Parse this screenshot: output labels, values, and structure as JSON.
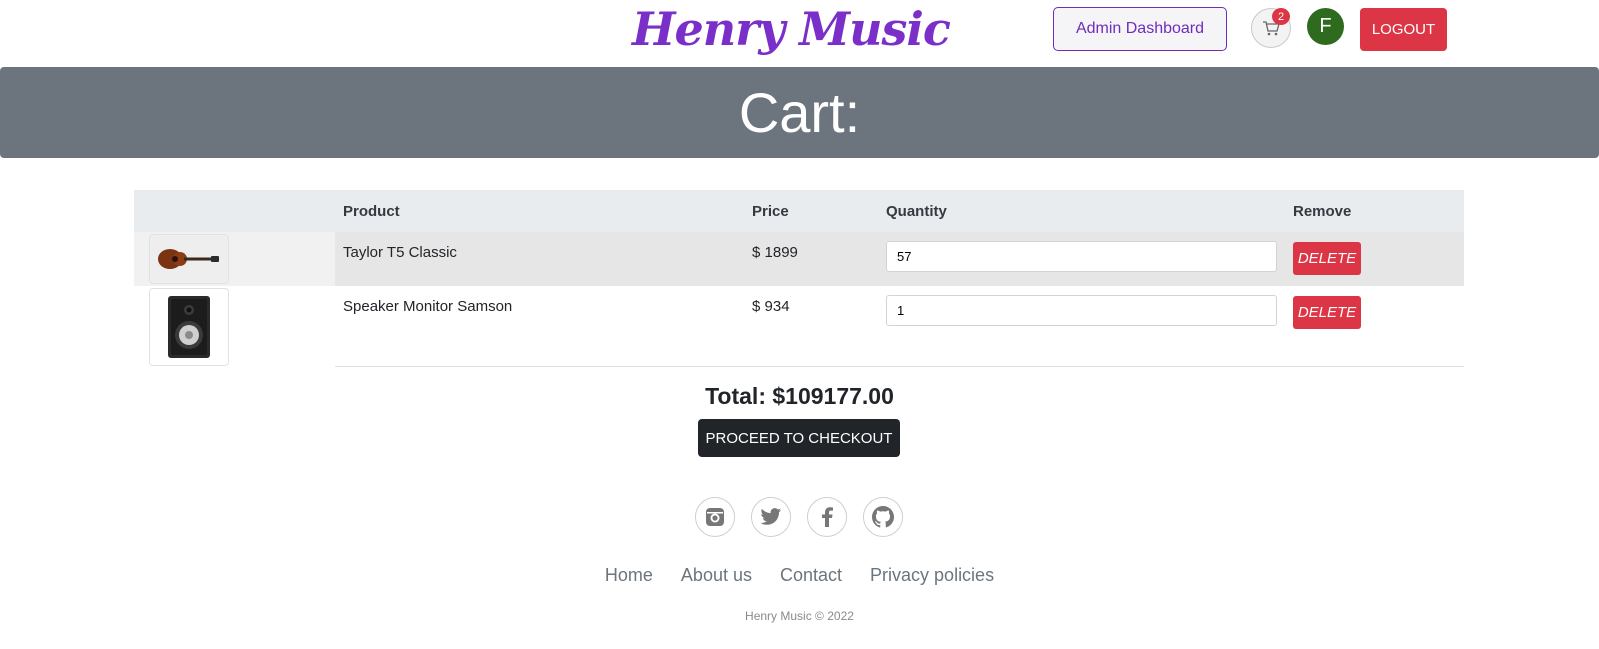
{
  "header": {
    "brand": "Henry Music",
    "admin_label": "Admin Dashboard",
    "cart_count": "2",
    "avatar_initial": "F",
    "logout_label": "LOGOUT"
  },
  "banner": {
    "title": "Cart:"
  },
  "table": {
    "headers": {
      "product": "Product",
      "price": "Price",
      "quantity": "Quantity",
      "remove": "Remove"
    },
    "rows": [
      {
        "product": "Taylor T5 Classic",
        "price": "$ 1899",
        "quantity": "57",
        "delete_label": "DELETE",
        "image_icon": "guitar-icon"
      },
      {
        "product": "Speaker Monitor Samson",
        "price": "$ 934",
        "quantity": "1",
        "delete_label": "DELETE",
        "image_icon": "speaker-icon"
      }
    ]
  },
  "summary": {
    "total": "Total: $109177.00",
    "checkout_label": "PROCEED TO CHECKOUT"
  },
  "footer": {
    "social_icons": [
      "instagram-icon",
      "twitter-icon",
      "facebook-icon",
      "github-icon"
    ],
    "links": [
      "Home",
      "About us",
      "Contact",
      "Privacy policies"
    ],
    "copyright": "Henry Music © 2022"
  },
  "colors": {
    "brand": "#7b2fc9",
    "banner": "#6c757d",
    "danger": "#dc3545",
    "dark": "#212529",
    "avatar": "#2e6b1f"
  }
}
